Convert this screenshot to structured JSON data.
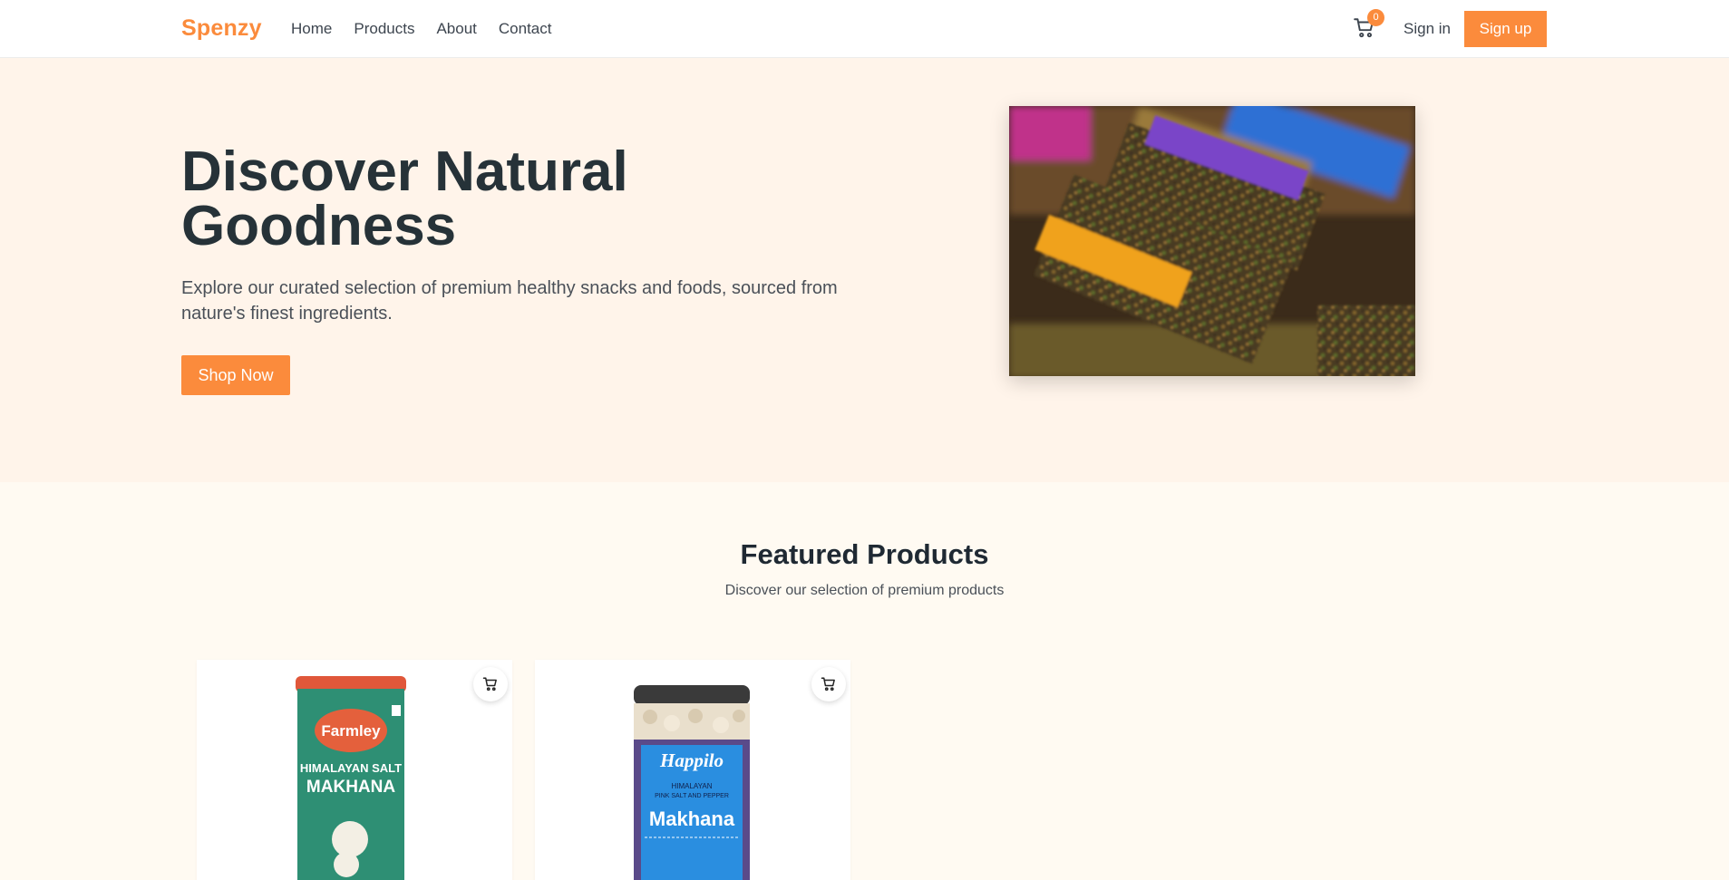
{
  "header": {
    "logo": "Spenzy",
    "nav": [
      "Home",
      "Products",
      "About",
      "Contact"
    ],
    "cart_count": "0",
    "signin_label": "Sign in",
    "signup_label": "Sign up"
  },
  "hero": {
    "title": "Discover Natural Goodness",
    "description": "Explore our curated selection of premium healthy snacks and foods, sourced from nature's finest ingredients.",
    "cta_label": "Shop Now"
  },
  "featured": {
    "title": "Featured Products",
    "subtitle": "Discover our selection of premium products",
    "products": [
      {
        "brand": "Farmley",
        "line1": "HIMALAYAN SALT",
        "line2": "MAKHANA"
      },
      {
        "brand": "Happilo",
        "line1": "HIMALAYAN",
        "line2": "PINK SALT AND PEPPER",
        "line3": "Makhana"
      }
    ]
  },
  "colors": {
    "accent": "#fb8b3c",
    "hero_bg": "#fff4ea",
    "page_bg": "#fffaf2",
    "heading": "#263238"
  },
  "icons": {
    "cart": "cart-icon"
  }
}
